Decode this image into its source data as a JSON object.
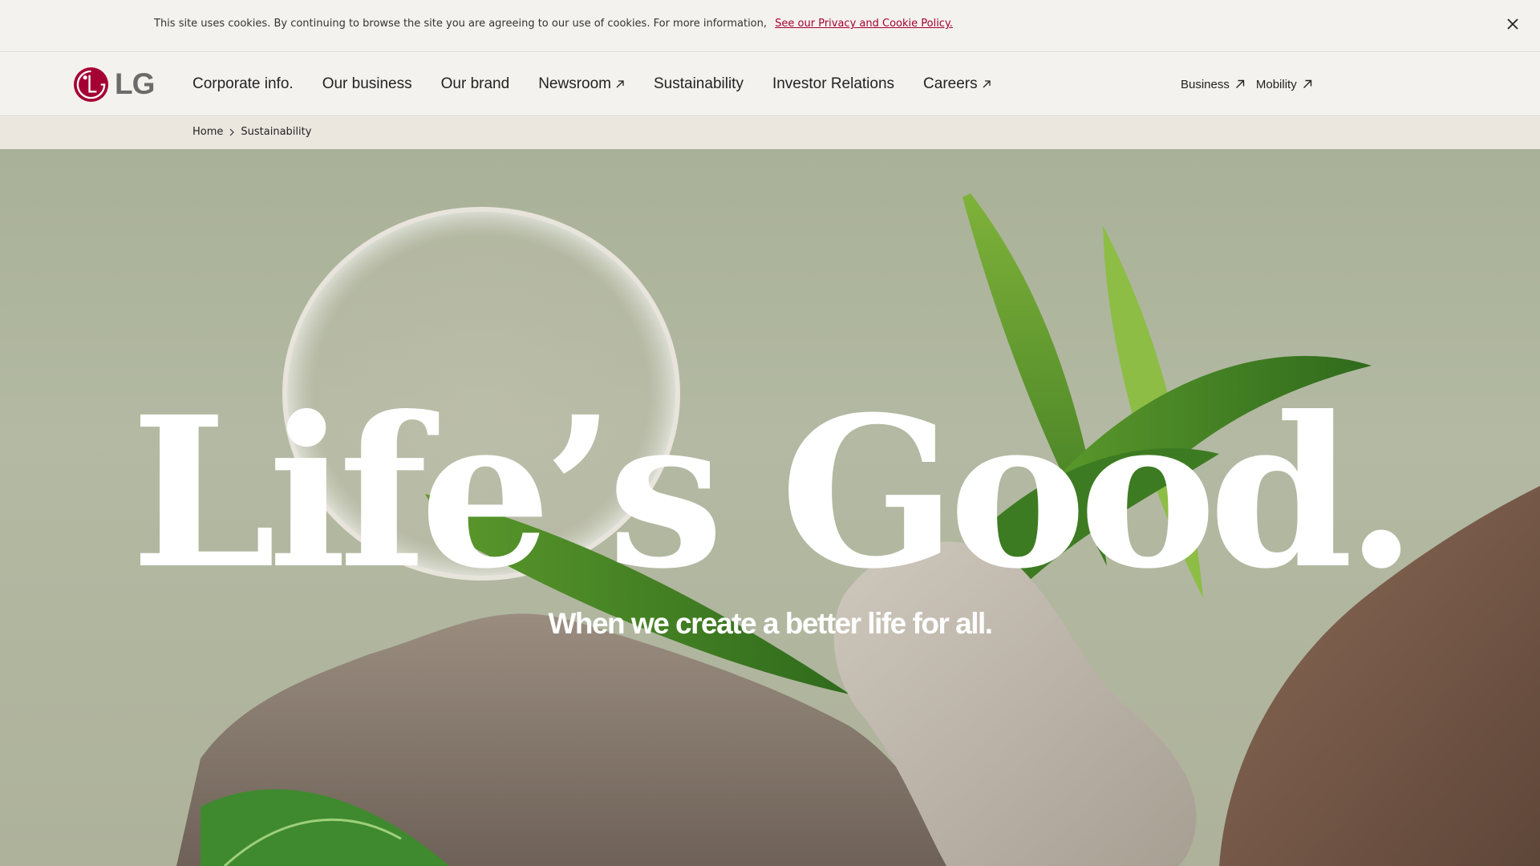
{
  "cookie_banner": {
    "text": "This site uses cookies. By continuing to browse the site you are agreeing to our use of cookies. For more information,",
    "link_text": "See our Privacy and Cookie Policy.",
    "close_icon": "close-icon"
  },
  "header": {
    "logo_text": "LG",
    "nav": [
      {
        "label": "Corporate info.",
        "external": false
      },
      {
        "label": "Our business",
        "external": false
      },
      {
        "label": "Our brand",
        "external": false
      },
      {
        "label": "Newsroom",
        "external": true
      },
      {
        "label": "Sustainability",
        "external": false
      },
      {
        "label": "Investor Relations",
        "external": false
      },
      {
        "label": "Careers",
        "external": true
      }
    ],
    "utility": [
      {
        "label": "Business",
        "external": true
      },
      {
        "label": "Mobility",
        "external": true
      }
    ]
  },
  "breadcrumb": {
    "home": "Home",
    "current": "Sustainability"
  },
  "hero": {
    "headline": "Life’s Good.",
    "subheadline": "When we create a better life for all."
  },
  "colors": {
    "brand": "#a50034",
    "background": "#f4f2ee",
    "breadcrumb_bg": "#ebe7df",
    "hero_bg": "#aeb49c"
  }
}
